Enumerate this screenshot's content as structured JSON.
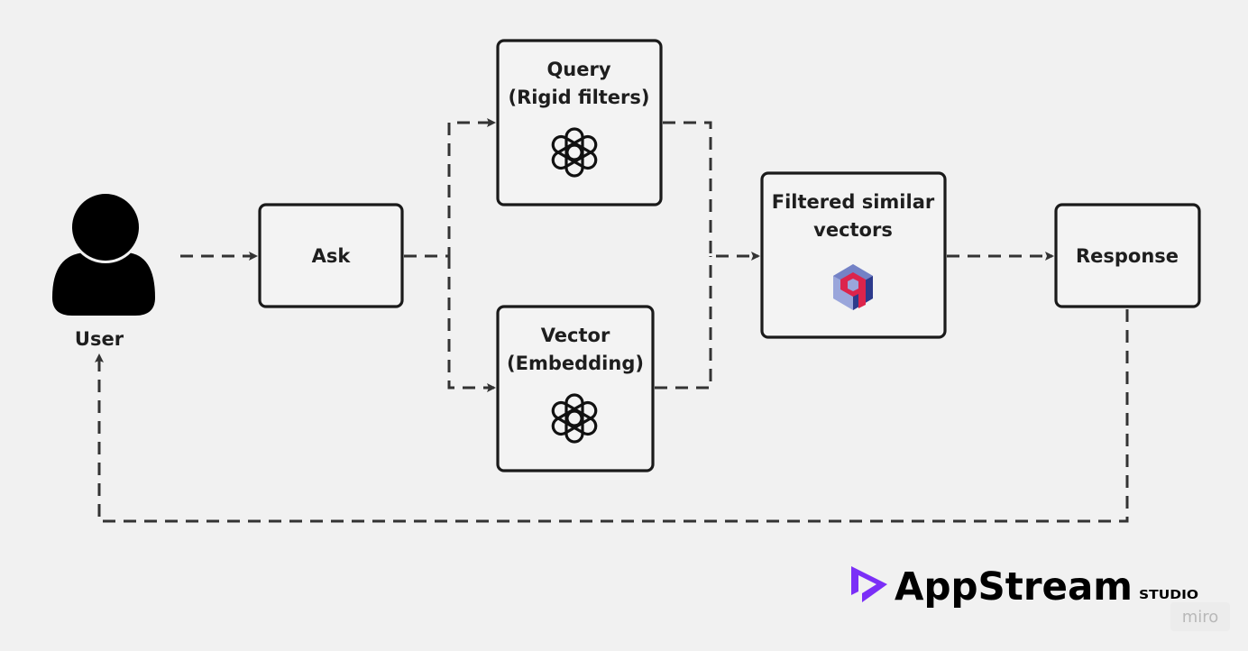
{
  "nodes": {
    "user": "User",
    "ask": "Ask",
    "query": [
      "Query",
      "(Rigid filters)"
    ],
    "vector": [
      "Vector",
      "(Embedding)"
    ],
    "filtered": [
      "Filtered similar",
      "vectors"
    ],
    "response": "Response"
  },
  "icons": {
    "user": "user-silhouette-icon",
    "query": "openai-icon",
    "vector": "openai-icon",
    "filtered": "qdrant-icon"
  },
  "branding": {
    "logo_text": "AppStream",
    "logo_suffix": "STUDIO",
    "watermark": "miro",
    "logo_color": "#7b2ff7"
  }
}
